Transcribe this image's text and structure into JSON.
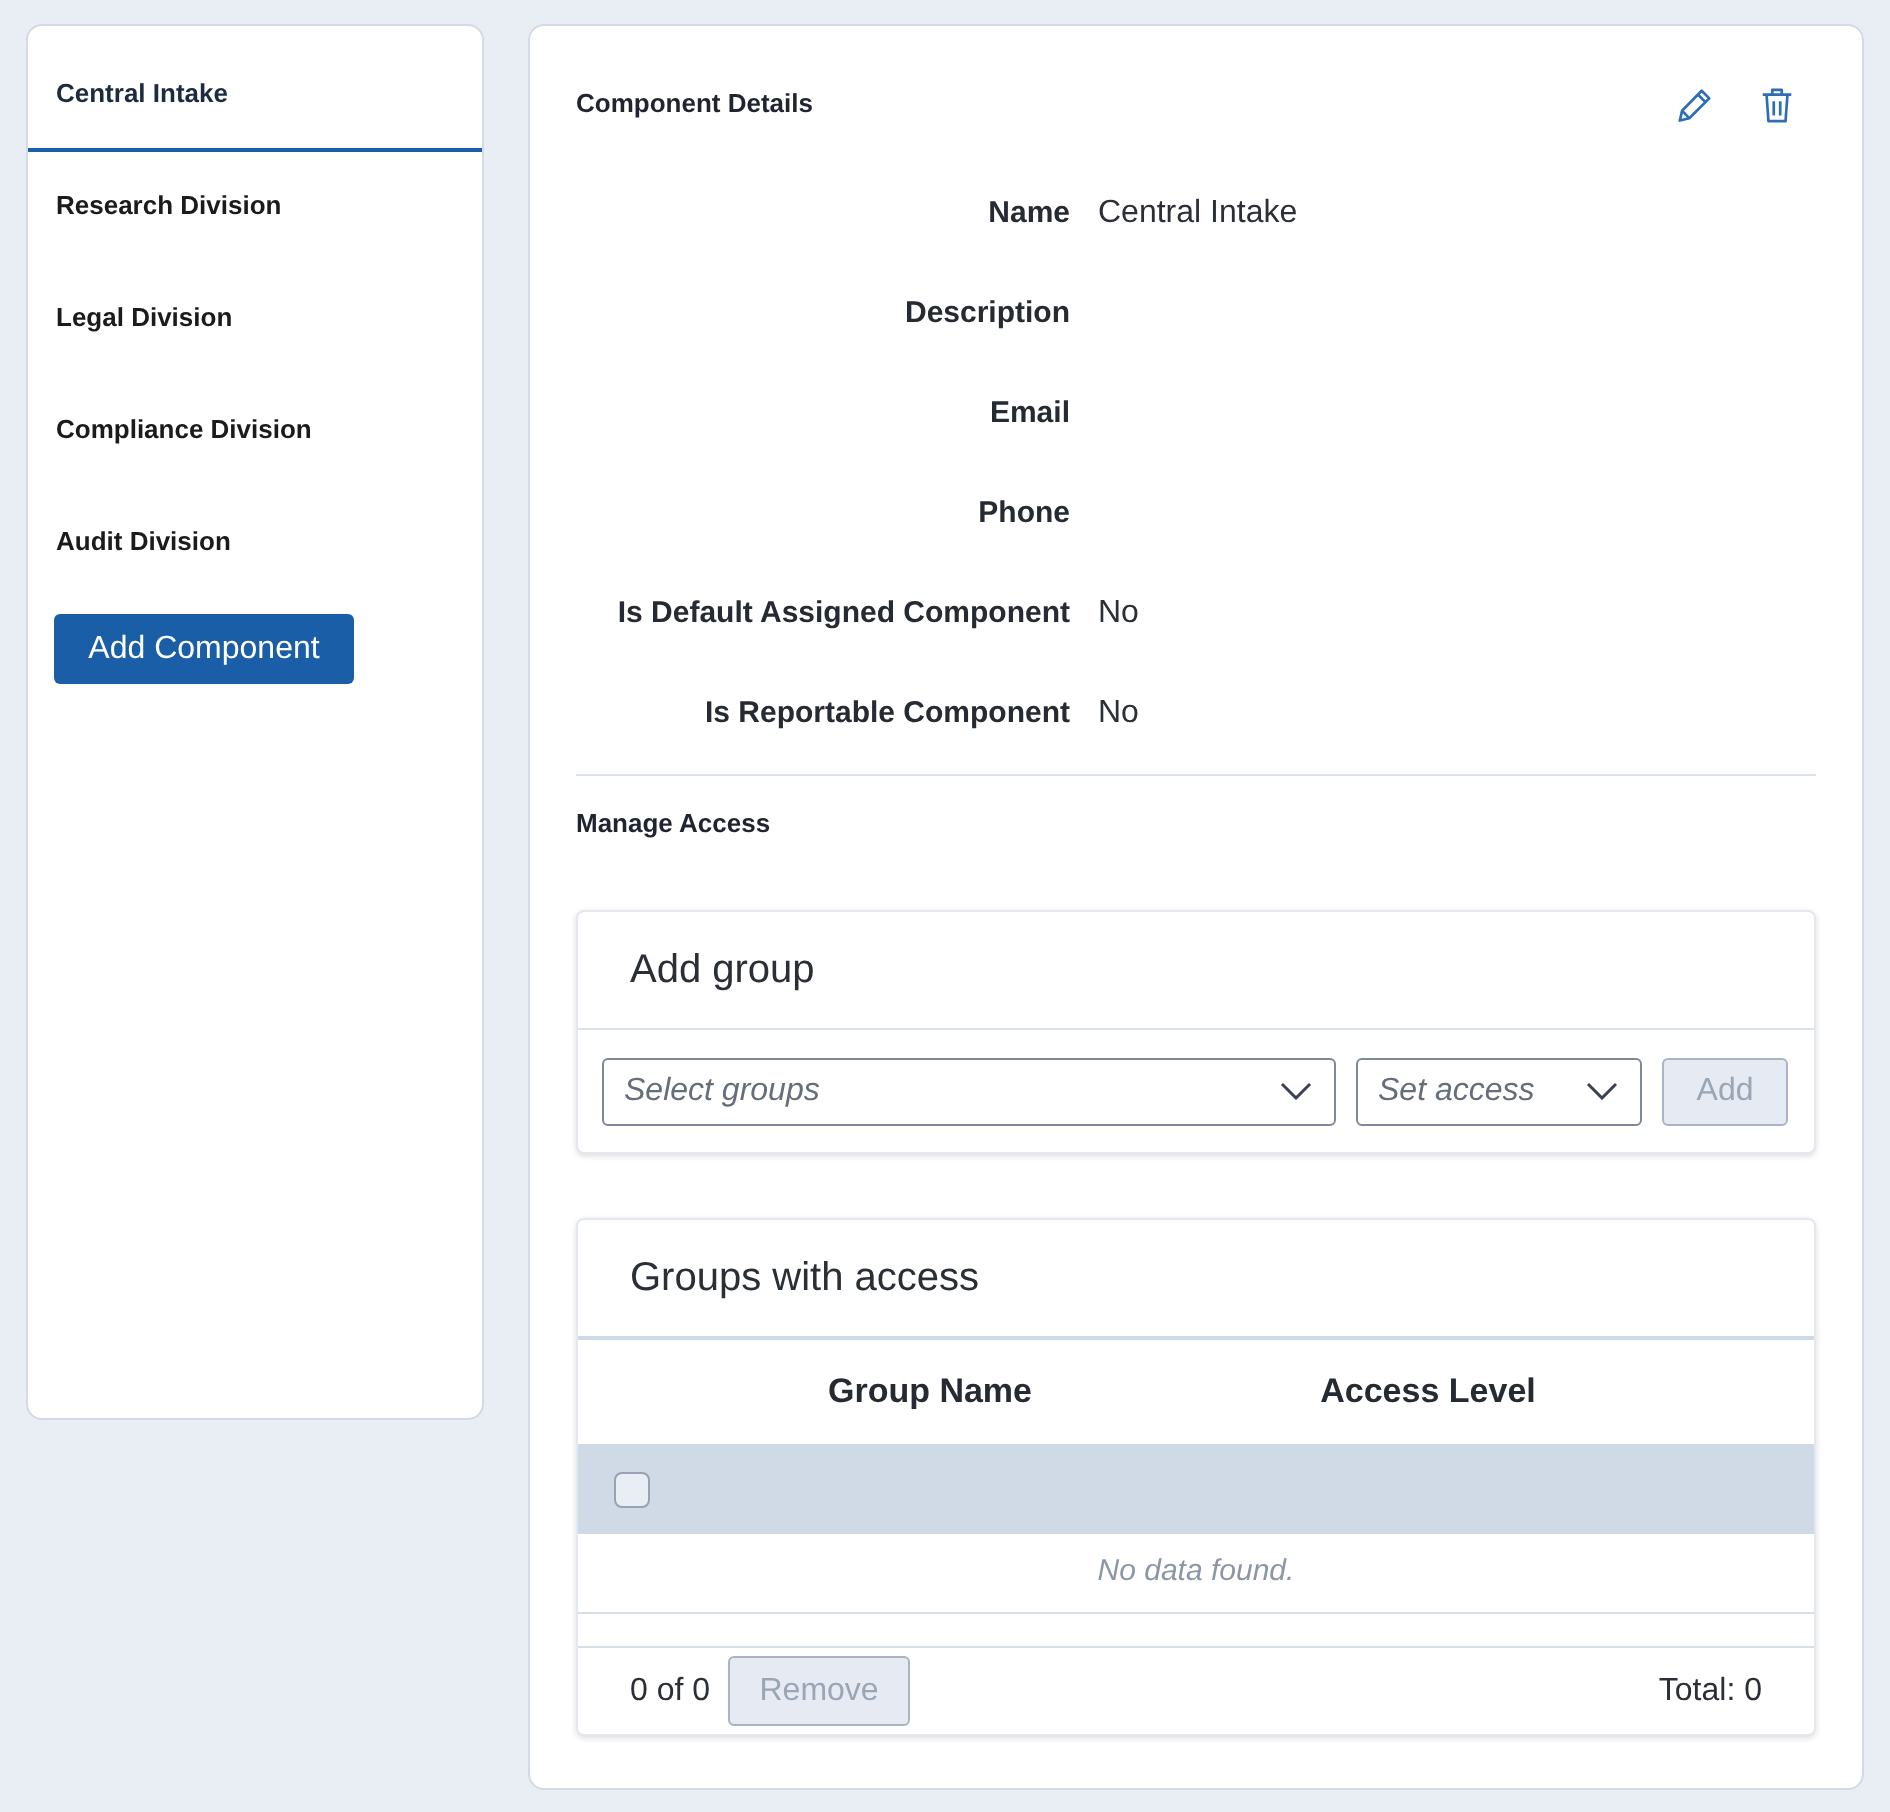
{
  "sidebar": {
    "items": [
      {
        "label": "Central Intake",
        "selected": true
      },
      {
        "label": "Research Division",
        "selected": false
      },
      {
        "label": "Legal Division",
        "selected": false
      },
      {
        "label": "Compliance Division",
        "selected": false
      },
      {
        "label": "Audit Division",
        "selected": false
      }
    ],
    "add_button": "Add Component"
  },
  "details": {
    "title": "Component Details",
    "fields": [
      {
        "label": "Name",
        "value": "Central Intake"
      },
      {
        "label": "Description"
      },
      {
        "label": "Email"
      },
      {
        "label": "Phone"
      },
      {
        "label": "Is Default Assigned Component",
        "value": "No"
      },
      {
        "label": "Is Reportable Component",
        "value": "No"
      }
    ]
  },
  "manage_access": {
    "title": "Manage Access",
    "add_group": {
      "title": "Add group",
      "groups_select": {
        "placeholder": "Select groups"
      },
      "access_select": {
        "placeholder": "Set access"
      },
      "add_button": {
        "label": "Add",
        "disabled": true
      }
    },
    "groups_table": {
      "title": "Groups with access",
      "columns": [
        "Group Name",
        "Access Level"
      ],
      "select_all": {
        "checked": false
      },
      "empty_message": "No data found.",
      "footer": {
        "selection": "0 of 0",
        "remove_button": {
          "label": "Remove",
          "disabled": true
        },
        "total": "Total: 0"
      }
    }
  }
}
